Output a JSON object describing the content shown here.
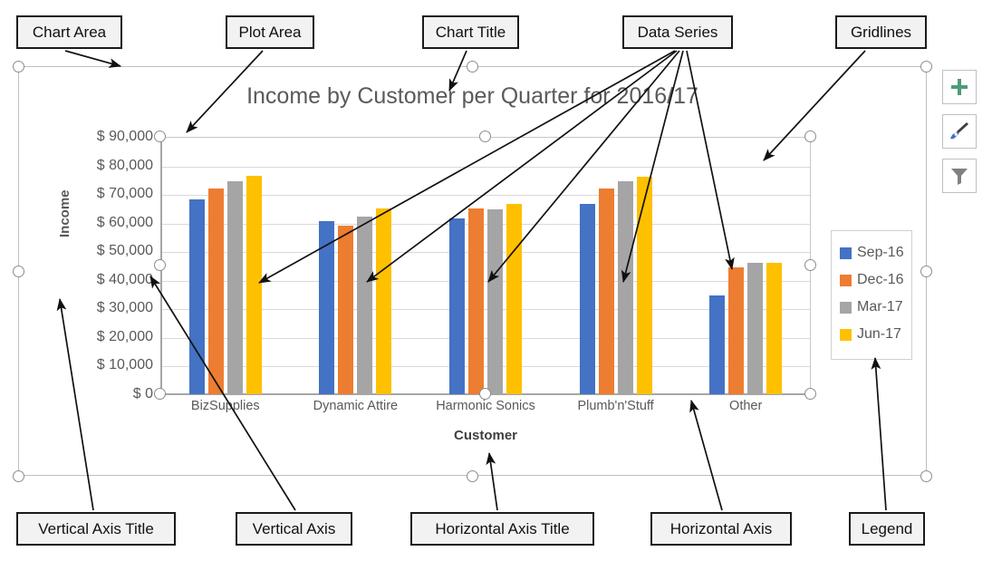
{
  "annotations": [
    {
      "key": "chart-area",
      "label": "Chart Area"
    },
    {
      "key": "plot-area",
      "label": "Plot Area"
    },
    {
      "key": "chart-title",
      "label": "Chart Title"
    },
    {
      "key": "data-series",
      "label": "Data Series"
    },
    {
      "key": "gridlines",
      "label": "Gridlines"
    },
    {
      "key": "vertical-axis-title",
      "label": "Vertical Axis Title"
    },
    {
      "key": "vertical-axis",
      "label": "Vertical Axis"
    },
    {
      "key": "horizontal-axis-title",
      "label": "Horizontal Axis Title"
    },
    {
      "key": "horizontal-axis",
      "label": "Horizontal Axis"
    },
    {
      "key": "legend",
      "label": "Legend"
    }
  ],
  "chart_buttons": [
    {
      "name": "chart-elements-button",
      "icon": "plus-icon",
      "color": "#4e9a7a"
    },
    {
      "name": "chart-styles-button",
      "icon": "paintbrush-icon",
      "color": "#4472c4"
    },
    {
      "name": "chart-filters-button",
      "icon": "funnel-icon",
      "color": "#7f7f7f"
    }
  ],
  "chart_data": {
    "type": "bar",
    "title": "Income by Customer per Quarter for 2016/17",
    "xlabel": "Customer",
    "ylabel": "Income",
    "categories": [
      "BizSupplies",
      "Dynamic Attire",
      "Harmonic Sonics",
      "Plumb'n'Stuff",
      "Other"
    ],
    "series": [
      {
        "name": "Sep-16",
        "color": "#4472c4",
        "values": [
          68000,
          60500,
          61500,
          66500,
          34500
        ]
      },
      {
        "name": "Dec-16",
        "color": "#ed7d31",
        "values": [
          71800,
          59000,
          65000,
          71800,
          44500
        ]
      },
      {
        "name": "Mar-17",
        "color": "#a5a5a5",
        "values": [
          74500,
          62000,
          64500,
          74500,
          46000
        ]
      },
      {
        "name": "Jun-17",
        "color": "#ffc000",
        "values": [
          76500,
          65000,
          66500,
          76000,
          46000
        ]
      }
    ],
    "ylim": [
      0,
      90000
    ],
    "ytick_labels": [
      "$ 90,000",
      "$ 80,000",
      "$ 70,000",
      "$ 60,000",
      "$ 50,000",
      "$ 40,000",
      "$ 30,000",
      "$ 20,000",
      "$ 10,000",
      "$ 0"
    ],
    "ytick_values": [
      90000,
      80000,
      70000,
      60000,
      50000,
      40000,
      30000,
      20000,
      10000,
      0
    ],
    "grid": true,
    "legend_position": "right"
  }
}
